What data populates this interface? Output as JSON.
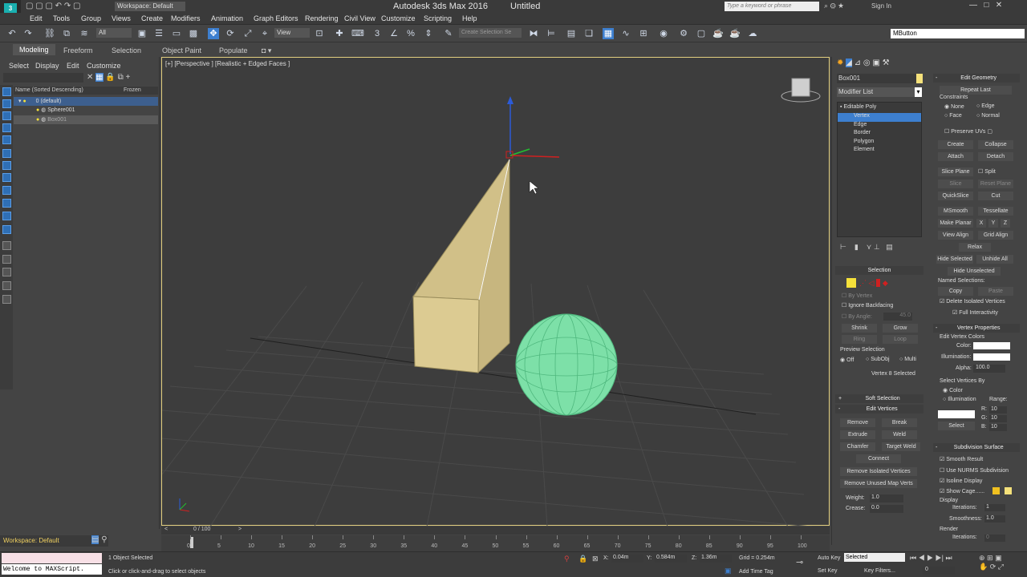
{
  "titlebar": {
    "title": "Autodesk 3ds Max 2016",
    "doc": "Untitled",
    "workspace": "Workspace: Default",
    "search_placeholder": "Type a keyword or phrase",
    "sign_in": "Sign In"
  },
  "menu": [
    "Edit",
    "Tools",
    "Group",
    "Views",
    "Create",
    "Modifiers",
    "Animation",
    "Graph Editors",
    "Rendering",
    "Civil View",
    "Customize",
    "Scripting",
    "Help"
  ],
  "toolbar": {
    "filter_all": "All",
    "ref_coord": "View",
    "selection_set": "Create Selection Se",
    "mxs_input": "MButton"
  },
  "ribbon": {
    "tabs": [
      "Modeling",
      "Freeform",
      "Selection",
      "Object Paint",
      "Populate"
    ]
  },
  "explorer": {
    "tabs": [
      "Select",
      "Display",
      "Edit",
      "Customize"
    ],
    "col_name": "Name (Sorted Descending)",
    "col_frozen": "Frozen",
    "rows": [
      "0 (default)",
      "Sphere001",
      "Box001"
    ]
  },
  "viewport": {
    "label": "[+] [Perspective ] [Realistic + Edged Faces ]"
  },
  "panel": {
    "object_name": "Box001",
    "modifier_list": "Modifier List",
    "stack": [
      "Editable Poly",
      "Vertex",
      "Edge",
      "Border",
      "Polygon",
      "Element"
    ],
    "selection": {
      "title": "Selection",
      "by_vertex": "By Vertex",
      "ignore_backfacing": "Ignore Backfacing",
      "by_angle": "By Angle:",
      "angle": "45.0",
      "shrink": "Shrink",
      "grow": "Grow",
      "ring": "Ring",
      "loop": "Loop",
      "preview": "Preview Selection",
      "off": "Off",
      "subobj": "SubObj",
      "multi": "Multi",
      "status": "Vertex 8 Selected"
    },
    "soft_selection": "Soft Selection",
    "edit_vertices": {
      "title": "Edit Vertices",
      "remove": "Remove",
      "break": "Break",
      "extrude": "Extrude",
      "weld": "Weld",
      "chamfer": "Chamfer",
      "target_weld": "Target Weld",
      "connect": "Connect",
      "remove_isolated": "Remove Isolated Vertices",
      "remove_unused": "Remove Unused Map Verts",
      "weight": "Weight:",
      "weight_val": "1.0",
      "crease": "Crease:",
      "crease_val": "0.0"
    },
    "edit_geometry": {
      "title": "Edit Geometry",
      "repeat_last": "Repeat Last",
      "constraints": "Constraints",
      "none": "None",
      "edge": "Edge",
      "face": "Face",
      "normal": "Normal",
      "preserve_uvs": "Preserve UVs",
      "create": "Create",
      "collapse": "Collapse",
      "attach": "Attach",
      "detach": "Detach",
      "slice_plane": "Slice Plane",
      "split": "Split",
      "slice": "Slice",
      "reset_plane": "Reset Plane",
      "quickslice": "QuickSlice",
      "cut": "Cut",
      "msmooth": "MSmooth",
      "tessellate": "Tessellate",
      "make_planar": "Make Planar",
      "x": "X",
      "y": "Y",
      "z": "Z",
      "view_align": "View Align",
      "grid_align": "Grid Align",
      "relax": "Relax",
      "hide_selected": "Hide Selected",
      "unhide_all": "Unhide All",
      "hide_unselected": "Hide Unselected",
      "named_selections": "Named Selections:",
      "copy": "Copy",
      "paste": "Paste",
      "delete_isolated": "Delete Isolated Vertices",
      "full_interactivity": "Full Interactivity"
    },
    "vertex_properties": {
      "title": "Vertex Properties",
      "edit_colors": "Edit Vertex Colors",
      "color": "Color:",
      "illumination": "Illumination:",
      "alpha": "Alpha:",
      "alpha_val": "100.0",
      "select_by": "Select Vertices By",
      "color_opt": "Color",
      "illum_opt": "Illumination",
      "range": "Range:",
      "r": "R:",
      "g": "G:",
      "b": "B:",
      "rv": "10",
      "gv": "10",
      "bv": "10",
      "select": "Select"
    },
    "subdivision": {
      "title": "Subdivision Surface",
      "smooth_result": "Smooth Result",
      "use_nurms": "Use NURMS Subdivision",
      "isoline": "Isoline Display",
      "show_cage": "Show Cage......",
      "display": "Display",
      "iterations": "Iterations:",
      "iterations_val": "1",
      "smoothness": "Smoothness:",
      "smoothness_val": "1.0",
      "render": "Render",
      "r_iterations": "Iterations:",
      "r_iterations_val": "0"
    }
  },
  "timeline": {
    "frame": "0 / 100",
    "ticks": [
      "0",
      "5",
      "10",
      "15",
      "20",
      "25",
      "30",
      "35",
      "40",
      "45",
      "50",
      "55",
      "60",
      "65",
      "70",
      "75",
      "80",
      "85",
      "90",
      "95",
      "100"
    ]
  },
  "status": {
    "workspace": "Workspace: Default",
    "maxscript": "Welcome to MAXScript.",
    "selected": "1 Object Selected",
    "prompt": "Click or click-and-drag to select objects",
    "x": "0.04m",
    "y": "0.584m",
    "z": "1.36m",
    "grid": "Grid = 0.254m",
    "add_time_tag": "Add Time Tag",
    "auto_key": "Auto Key",
    "set_key": "Set Key",
    "selected_dd": "Selected",
    "key_filters": "Key Filters...",
    "frame_val": "0"
  },
  "colors": {
    "accent": "#3d7fcf",
    "box": "#d7c68a",
    "sphere": "#7de0a8",
    "highlight": "#f5e13a"
  }
}
